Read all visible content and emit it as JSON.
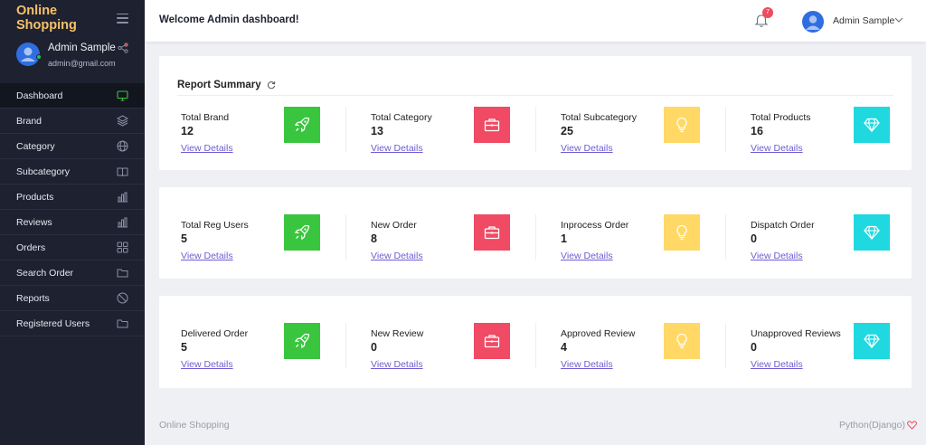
{
  "app": {
    "title": "Online Shopping"
  },
  "profile": {
    "name": "Admin Sample",
    "email": "admin@gmail.com"
  },
  "menu": [
    {
      "label": "Dashboard",
      "icon": "monitor-icon",
      "active": true
    },
    {
      "label": "Brand",
      "icon": "layers-icon"
    },
    {
      "label": "Category",
      "icon": "globe-icon"
    },
    {
      "label": "Subcategory",
      "icon": "book-icon"
    },
    {
      "label": "Products",
      "icon": "bar-chart-icon"
    },
    {
      "label": "Reviews",
      "icon": "bar-chart-icon"
    },
    {
      "label": "Orders",
      "icon": "grid-icon"
    },
    {
      "label": "Search Order",
      "icon": "folder-icon"
    },
    {
      "label": "Reports",
      "icon": "block-icon"
    },
    {
      "label": "Registered Users",
      "icon": "folder-icon"
    }
  ],
  "header": {
    "welcome": "Welcome Admin dashboard!",
    "notification_count": "7",
    "user_name": "Admin Sample"
  },
  "summary": {
    "title": "Report Summary"
  },
  "link_label": "View Details",
  "colors": {
    "green": "#3ac53e",
    "red": "#f04a64",
    "yellow": "#ffd866",
    "cyan": "#1fd8e0",
    "sidebar": "#1e2130",
    "accent": "#f5c26b"
  },
  "rows": [
    [
      {
        "label": "Total Brand",
        "value": "12",
        "icon": "rocket-icon",
        "color": "green"
      },
      {
        "label": "Total Category",
        "value": "13",
        "icon": "briefcase-icon",
        "color": "red"
      },
      {
        "label": "Total Subcategory",
        "value": "25",
        "icon": "lightbulb-icon",
        "color": "yellow"
      },
      {
        "label": "Total Products",
        "value": "16",
        "icon": "diamond-icon",
        "color": "cyan"
      }
    ],
    [
      {
        "label": "Total Reg Users",
        "value": "5",
        "icon": "rocket-icon",
        "color": "green"
      },
      {
        "label": "New Order",
        "value": "8",
        "icon": "briefcase-icon",
        "color": "red"
      },
      {
        "label": "Inprocess Order",
        "value": "1",
        "icon": "lightbulb-icon",
        "color": "yellow"
      },
      {
        "label": "Dispatch Order",
        "value": "0",
        "icon": "diamond-icon",
        "color": "cyan"
      }
    ],
    [
      {
        "label": "Delivered Order",
        "value": "5",
        "icon": "rocket-icon",
        "color": "green"
      },
      {
        "label": "New Review",
        "value": "0",
        "icon": "briefcase-icon",
        "color": "red"
      },
      {
        "label": "Approved Review",
        "value": "4",
        "icon": "lightbulb-icon",
        "color": "yellow"
      },
      {
        "label": "Unapproved Reviews",
        "value": "0",
        "icon": "diamond-icon",
        "color": "cyan"
      }
    ]
  ],
  "footer": {
    "left": "Online Shopping",
    "right": "Python(Django)"
  }
}
